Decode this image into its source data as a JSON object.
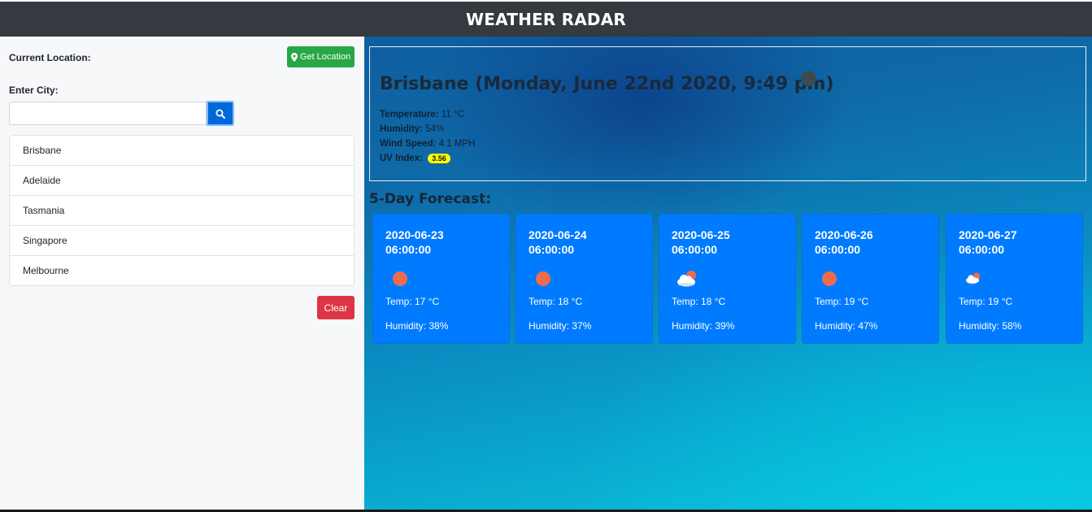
{
  "header": {
    "title": "WEATHER RADAR"
  },
  "sidebar": {
    "current_location_label": "Current Location:",
    "get_location_label": "Get Location",
    "enter_city_label": "Enter City:",
    "city_input_value": "",
    "city_input_placeholder": "",
    "search_icon": "search-icon",
    "cities": [
      "Brisbane",
      "Adelaide",
      "Tasmania",
      "Singapore",
      "Melbourne"
    ],
    "clear_label": "Clear"
  },
  "current": {
    "title": "Brisbane (Monday, June 22nd 2020, 9:49 pm)",
    "weather_icon": "moon-clear-night-icon",
    "temperature_label": "Temperature:",
    "temperature_value": "11 °C",
    "humidity_label": "Humidity:",
    "humidity_value": "54%",
    "wind_label": "Wind Speed:",
    "wind_value": "4.1 MPH",
    "uv_label": "UV Index:",
    "uv_value": "3.56"
  },
  "forecast": {
    "heading": "5-Day Forecast:",
    "days": [
      {
        "date": "2020-06-23",
        "time": "06:00:00",
        "icon": "sun-icon",
        "temp": "Temp: 17 °C",
        "humidity": "Humidity: 38%"
      },
      {
        "date": "2020-06-24",
        "time": "06:00:00",
        "icon": "sun-icon",
        "temp": "Temp: 18 °C",
        "humidity": "Humidity: 37%"
      },
      {
        "date": "2020-06-25",
        "time": "06:00:00",
        "icon": "partly-cloudy-icon",
        "temp": "Temp: 18 °C",
        "humidity": "Humidity: 39%"
      },
      {
        "date": "2020-06-26",
        "time": "06:00:00",
        "icon": "sun-icon",
        "temp": "Temp: 19 °C",
        "humidity": "Humidity: 47%"
      },
      {
        "date": "2020-06-27",
        "time": "06:00:00",
        "icon": "rain-cloud-icon",
        "temp": "Temp: 19 °C",
        "humidity": "Humidity: 58%"
      }
    ]
  },
  "colors": {
    "navbar": "#343a40",
    "get_location_button": "#28a745",
    "search_button": "#0069d9",
    "clear_button": "#dc3545",
    "forecast_card": "#007bff",
    "uv_badge": "#ffff00"
  }
}
